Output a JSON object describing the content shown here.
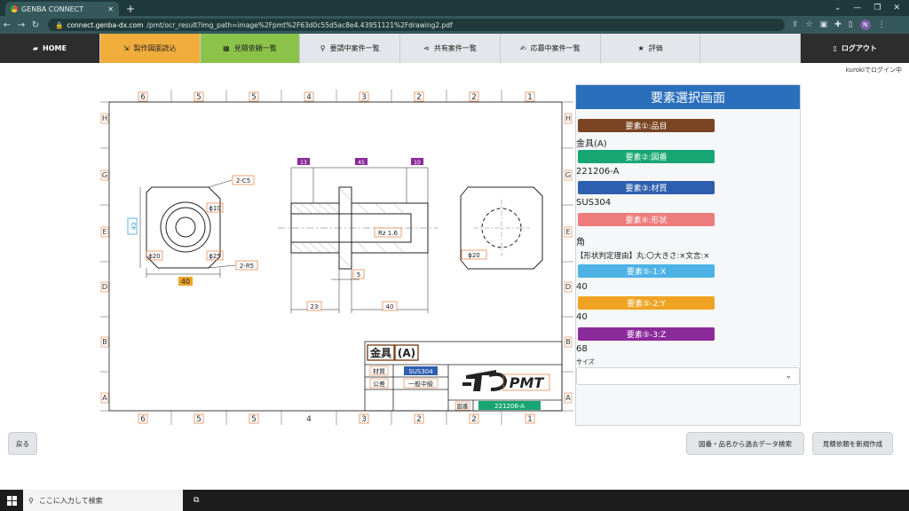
{
  "browser": {
    "tab_title": "GENBA CONNECT",
    "url_host": "connect.genba-dx.com",
    "url_path": "/pmt/ocr_result?img_path=image%2Fpmt%2F63d0c55d5ac8e4.43951121%2Fdrawing2.pdf"
  },
  "nav": {
    "home": "HOME",
    "read": "製作図面読込",
    "estimate_list": "見積依頼一覧",
    "requesting": "要請中案件一覧",
    "shared": "共有案件一覧",
    "applying": "応募中案件一覧",
    "rating": "評価",
    "logout": "ログアウト"
  },
  "login_note": "kurokiでログイン中",
  "panel": {
    "title": "要素選択画面",
    "elements": [
      {
        "label": "要素①:品目",
        "value": "金具(A)",
        "color": "#7a4422"
      },
      {
        "label": "要素②:図番",
        "value": "221206-A",
        "color": "#17a673"
      },
      {
        "label": "要素③:材質",
        "value": "SUS304",
        "color": "#2d5fae"
      },
      {
        "label": "要素④:形状",
        "value": "角",
        "color": "#ee7b7b"
      },
      {
        "label": "要素⑤-1:X",
        "value": "40",
        "color": "#4db2e6"
      },
      {
        "label": "要素⑤-2:Y",
        "value": "40",
        "color": "#f0a323"
      },
      {
        "label": "要素⑤-3:Z",
        "value": "68",
        "color": "#8b2a9a"
      }
    ],
    "shape_reason": "【形状判定理由】丸:〇大きさ:×文言:×",
    "size_label": "サイズ"
  },
  "buttons": {
    "back": "戻る",
    "search_past": "図番・品名から過去データ検索",
    "new_estimate": "見積依頼を新規作成"
  },
  "drawing": {
    "col_labels": [
      "6",
      "5",
      "5",
      "4",
      "3",
      "2",
      "2",
      "1"
    ],
    "row_labels": [
      "H",
      "G",
      "E",
      "D",
      "B",
      "A"
    ],
    "title_block": {
      "name": "金具",
      "name_suffix": "(A)",
      "material_label": "材質",
      "material": "SUS304",
      "tolerance_label": "公差",
      "tolerance": "一般中級",
      "dwg_label": "図番",
      "dwg_no": "221206-A",
      "logo": "PMT"
    },
    "dims": {
      "w40": "40",
      "h40": "40",
      "c2": "2-C5",
      "r2": "2-R5",
      "phi10": "ϕ10",
      "phi20": "ϕ20",
      "phi25": "ϕ25",
      "phi20b": "ϕ20",
      "d13": "13",
      "d45": "45",
      "d10": "10",
      "rz": "Rz 1.6",
      "d5": "5",
      "d23": "23",
      "d40": "40"
    }
  },
  "taskbar": {
    "search_placeholder": "ここに入力して検索"
  }
}
